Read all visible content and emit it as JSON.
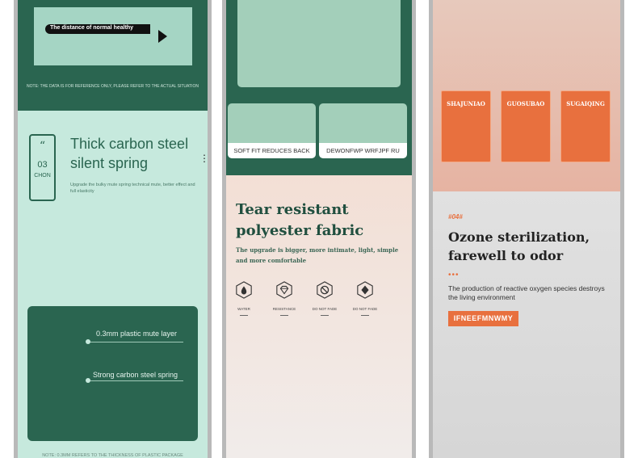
{
  "panel1": {
    "arrow_text": "The distance of normal healthy",
    "note_top": "NOTE: THE DATA IS FOR REFERENCE ONLY, PLEASE REFER TO THE ACTUAL SITUATION",
    "tag": {
      "quote": "“",
      "number": "03",
      "label": "CHON"
    },
    "heading": "Thick carbon steel silent spring",
    "description": "Upgrade the bulky mute spring technical mute, better effect and full elasticity",
    "menu_dots": "⋮",
    "features": [
      "0.3mm plastic mute layer",
      "Strong carbon steel spring"
    ],
    "note_bottom": "NOTE: 0.3MM REFERS TO THE THICKNESS OF PLASTIC PACKAGE"
  },
  "panel2": {
    "cards": [
      "SOFT FIT REDUCES BACK",
      "DEWONFWP WRFJPF RU"
    ],
    "heading": "Tear resistant polyester fabric",
    "description": "The upgrade is bigger, more intimate, light, simple and more comfortable",
    "icons": [
      {
        "label": "WATER",
        "icon": "water-drop-icon"
      },
      {
        "label": "RESISTANCE",
        "icon": "diamond-icon"
      },
      {
        "label": "DO NOT FADE",
        "icon": "no-fade-icon"
      },
      {
        "label": "DO NOT FADE",
        "icon": "shield-diamond-icon"
      }
    ]
  },
  "panel3": {
    "boxes": [
      "SHAJUNIAO",
      "GUOSUBAO",
      "SUGAIQING"
    ],
    "number": "#04#",
    "heading": "Ozone sterilization, farewell to odor",
    "dots": "•••",
    "description": "The production of reactive oxygen species destroys the living environment",
    "button": "IFNEEFMNWMY"
  },
  "colors": {
    "dark_green": "#2a6550",
    "mint": "#c6e9dd",
    "orange": "#e8703e"
  }
}
